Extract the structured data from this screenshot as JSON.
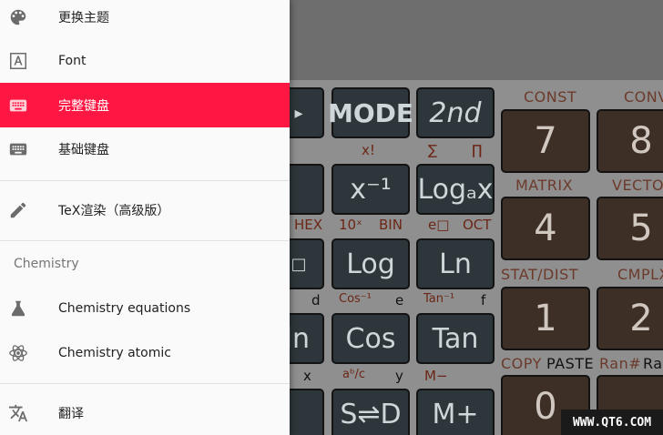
{
  "drawer": {
    "items": [
      {
        "label": "更换主题",
        "icon": "palette-icon"
      },
      {
        "label": "Font",
        "icon": "font-icon"
      },
      {
        "label": "完整键盘",
        "icon": "keyboard-icon",
        "active": true
      },
      {
        "label": "基础键盘",
        "icon": "keyboard-icon"
      },
      {
        "label": "TeX渲染（高级版）",
        "icon": "pencil-icon"
      }
    ],
    "section_title": "Chemistry",
    "chem_items": [
      {
        "label": "Chemistry equations",
        "icon": "flask-icon"
      },
      {
        "label": "Chemistry atomic",
        "icon": "atom-icon"
      }
    ],
    "footer_item": {
      "label": "翻译",
      "icon": "translate-icon"
    },
    "active_color": "#ff1744"
  },
  "calculator": {
    "buttons": {
      "mode": "MODE",
      "second": "2nd",
      "inverse": "x⁻¹",
      "log_a": "Logₐx",
      "log": "Log",
      "ln": "Ln",
      "ln_partial": "ln",
      "cos": "Cos",
      "tan": "Tan",
      "s_to_d": "S⇌D",
      "m_plus": "M+",
      "seven": "7",
      "eight": "8",
      "four": "4",
      "five": "5",
      "one": "1",
      "two": "2",
      "zero": "0"
    },
    "labels": {
      "const": "CONST",
      "conv": "CONV",
      "matrix": "MATRIX",
      "vector": "VECTO",
      "stat_dist": "STAT/DIST",
      "cmplx": "CMPLX",
      "copy": "COPY",
      "paste": "PASTE",
      "ran": "Ran#",
      "ran2": "Ran",
      "factorial": "x!",
      "sum": "∑",
      "product": "∏",
      "hex": "HEX",
      "ten_x": "10ˣ",
      "bin": "BIN",
      "e_box": "e□",
      "oct": "OCT",
      "d": "d",
      "cos_inv": "Cos⁻¹",
      "e": "e",
      "tan_inv": "Tan⁻¹",
      "f": "f",
      "x": "x",
      "ab_c": "aᵇ/c",
      "y": "y",
      "m_minus": "M−"
    }
  },
  "watermark": "WWW.QT6.COM"
}
